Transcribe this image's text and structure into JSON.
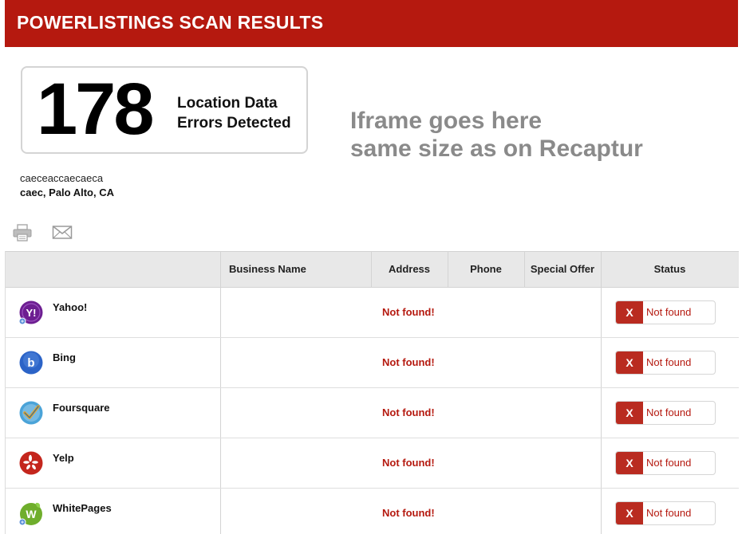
{
  "header": {
    "title": "POWERLISTINGS SCAN RESULTS"
  },
  "summary": {
    "count": "178",
    "label_line1": "Location Data",
    "label_line2": "Errors Detected"
  },
  "iframe_note": {
    "line1": "Iframe goes here",
    "line2": "same size as on Recaptur"
  },
  "business": {
    "name": "caeceaccaecaeca",
    "location": "caec, Palo Alto, CA"
  },
  "toolbar": {
    "print_icon": "printer-icon",
    "email_icon": "envelope-icon"
  },
  "table": {
    "columns": {
      "business_name": "Business Name",
      "address": "Address",
      "phone": "Phone",
      "special_offer": "Special Offer",
      "status": "Status"
    },
    "rows": [
      {
        "site": "Yahoo!",
        "icon": "yahoo-logo",
        "color": "#6d1e91",
        "result": "Not found!",
        "status_mark": "X",
        "status": "Not found"
      },
      {
        "site": "Bing",
        "icon": "bing-logo",
        "color": "#2b63c7",
        "result": "Not found!",
        "status_mark": "X",
        "status": "Not found"
      },
      {
        "site": "Foursquare",
        "icon": "foursquare-logo",
        "color": "#4aa3d8",
        "result": "Not found!",
        "status_mark": "X",
        "status": "Not found"
      },
      {
        "site": "Yelp",
        "icon": "yelp-logo",
        "color": "#c4261d",
        "result": "Not found!",
        "status_mark": "X",
        "status": "Not found"
      },
      {
        "site": "WhitePages",
        "icon": "whitepages-logo",
        "color": "#6fae2c",
        "result": "Not found!",
        "status_mark": "X",
        "status": "Not found"
      }
    ]
  },
  "colors": {
    "brand_red": "#b5190f",
    "status_red": "#b92b20",
    "header_gray": "#e8e8e8"
  }
}
